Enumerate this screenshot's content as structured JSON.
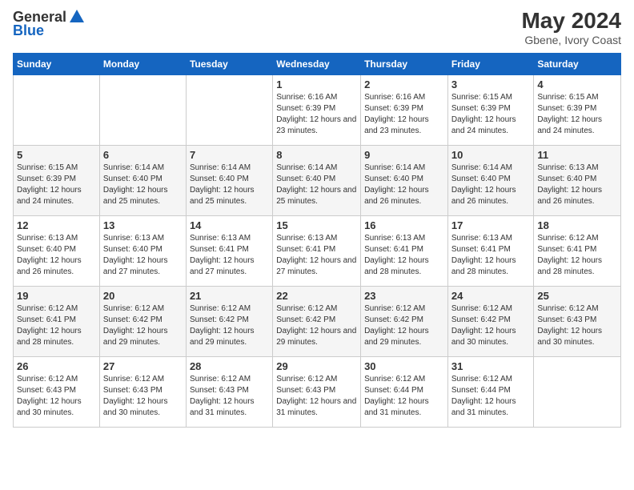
{
  "header": {
    "logo_general": "General",
    "logo_blue": "Blue",
    "month_year": "May 2024",
    "location": "Gbene, Ivory Coast"
  },
  "days_of_week": [
    "Sunday",
    "Monday",
    "Tuesday",
    "Wednesday",
    "Thursday",
    "Friday",
    "Saturday"
  ],
  "weeks": [
    [
      {
        "day": "",
        "sunrise": "",
        "sunset": "",
        "daylight": ""
      },
      {
        "day": "",
        "sunrise": "",
        "sunset": "",
        "daylight": ""
      },
      {
        "day": "",
        "sunrise": "",
        "sunset": "",
        "daylight": ""
      },
      {
        "day": "1",
        "sunrise": "Sunrise: 6:16 AM",
        "sunset": "Sunset: 6:39 PM",
        "daylight": "Daylight: 12 hours and 23 minutes."
      },
      {
        "day": "2",
        "sunrise": "Sunrise: 6:16 AM",
        "sunset": "Sunset: 6:39 PM",
        "daylight": "Daylight: 12 hours and 23 minutes."
      },
      {
        "day": "3",
        "sunrise": "Sunrise: 6:15 AM",
        "sunset": "Sunset: 6:39 PM",
        "daylight": "Daylight: 12 hours and 24 minutes."
      },
      {
        "day": "4",
        "sunrise": "Sunrise: 6:15 AM",
        "sunset": "Sunset: 6:39 PM",
        "daylight": "Daylight: 12 hours and 24 minutes."
      }
    ],
    [
      {
        "day": "5",
        "sunrise": "Sunrise: 6:15 AM",
        "sunset": "Sunset: 6:39 PM",
        "daylight": "Daylight: 12 hours and 24 minutes."
      },
      {
        "day": "6",
        "sunrise": "Sunrise: 6:14 AM",
        "sunset": "Sunset: 6:40 PM",
        "daylight": "Daylight: 12 hours and 25 minutes."
      },
      {
        "day": "7",
        "sunrise": "Sunrise: 6:14 AM",
        "sunset": "Sunset: 6:40 PM",
        "daylight": "Daylight: 12 hours and 25 minutes."
      },
      {
        "day": "8",
        "sunrise": "Sunrise: 6:14 AM",
        "sunset": "Sunset: 6:40 PM",
        "daylight": "Daylight: 12 hours and 25 minutes."
      },
      {
        "day": "9",
        "sunrise": "Sunrise: 6:14 AM",
        "sunset": "Sunset: 6:40 PM",
        "daylight": "Daylight: 12 hours and 26 minutes."
      },
      {
        "day": "10",
        "sunrise": "Sunrise: 6:14 AM",
        "sunset": "Sunset: 6:40 PM",
        "daylight": "Daylight: 12 hours and 26 minutes."
      },
      {
        "day": "11",
        "sunrise": "Sunrise: 6:13 AM",
        "sunset": "Sunset: 6:40 PM",
        "daylight": "Daylight: 12 hours and 26 minutes."
      }
    ],
    [
      {
        "day": "12",
        "sunrise": "Sunrise: 6:13 AM",
        "sunset": "Sunset: 6:40 PM",
        "daylight": "Daylight: 12 hours and 26 minutes."
      },
      {
        "day": "13",
        "sunrise": "Sunrise: 6:13 AM",
        "sunset": "Sunset: 6:40 PM",
        "daylight": "Daylight: 12 hours and 27 minutes."
      },
      {
        "day": "14",
        "sunrise": "Sunrise: 6:13 AM",
        "sunset": "Sunset: 6:41 PM",
        "daylight": "Daylight: 12 hours and 27 minutes."
      },
      {
        "day": "15",
        "sunrise": "Sunrise: 6:13 AM",
        "sunset": "Sunset: 6:41 PM",
        "daylight": "Daylight: 12 hours and 27 minutes."
      },
      {
        "day": "16",
        "sunrise": "Sunrise: 6:13 AM",
        "sunset": "Sunset: 6:41 PM",
        "daylight": "Daylight: 12 hours and 28 minutes."
      },
      {
        "day": "17",
        "sunrise": "Sunrise: 6:13 AM",
        "sunset": "Sunset: 6:41 PM",
        "daylight": "Daylight: 12 hours and 28 minutes."
      },
      {
        "day": "18",
        "sunrise": "Sunrise: 6:12 AM",
        "sunset": "Sunset: 6:41 PM",
        "daylight": "Daylight: 12 hours and 28 minutes."
      }
    ],
    [
      {
        "day": "19",
        "sunrise": "Sunrise: 6:12 AM",
        "sunset": "Sunset: 6:41 PM",
        "daylight": "Daylight: 12 hours and 28 minutes."
      },
      {
        "day": "20",
        "sunrise": "Sunrise: 6:12 AM",
        "sunset": "Sunset: 6:42 PM",
        "daylight": "Daylight: 12 hours and 29 minutes."
      },
      {
        "day": "21",
        "sunrise": "Sunrise: 6:12 AM",
        "sunset": "Sunset: 6:42 PM",
        "daylight": "Daylight: 12 hours and 29 minutes."
      },
      {
        "day": "22",
        "sunrise": "Sunrise: 6:12 AM",
        "sunset": "Sunset: 6:42 PM",
        "daylight": "Daylight: 12 hours and 29 minutes."
      },
      {
        "day": "23",
        "sunrise": "Sunrise: 6:12 AM",
        "sunset": "Sunset: 6:42 PM",
        "daylight": "Daylight: 12 hours and 29 minutes."
      },
      {
        "day": "24",
        "sunrise": "Sunrise: 6:12 AM",
        "sunset": "Sunset: 6:42 PM",
        "daylight": "Daylight: 12 hours and 30 minutes."
      },
      {
        "day": "25",
        "sunrise": "Sunrise: 6:12 AM",
        "sunset": "Sunset: 6:43 PM",
        "daylight": "Daylight: 12 hours and 30 minutes."
      }
    ],
    [
      {
        "day": "26",
        "sunrise": "Sunrise: 6:12 AM",
        "sunset": "Sunset: 6:43 PM",
        "daylight": "Daylight: 12 hours and 30 minutes."
      },
      {
        "day": "27",
        "sunrise": "Sunrise: 6:12 AM",
        "sunset": "Sunset: 6:43 PM",
        "daylight": "Daylight: 12 hours and 30 minutes."
      },
      {
        "day": "28",
        "sunrise": "Sunrise: 6:12 AM",
        "sunset": "Sunset: 6:43 PM",
        "daylight": "Daylight: 12 hours and 31 minutes."
      },
      {
        "day": "29",
        "sunrise": "Sunrise: 6:12 AM",
        "sunset": "Sunset: 6:43 PM",
        "daylight": "Daylight: 12 hours and 31 minutes."
      },
      {
        "day": "30",
        "sunrise": "Sunrise: 6:12 AM",
        "sunset": "Sunset: 6:44 PM",
        "daylight": "Daylight: 12 hours and 31 minutes."
      },
      {
        "day": "31",
        "sunrise": "Sunrise: 6:12 AM",
        "sunset": "Sunset: 6:44 PM",
        "daylight": "Daylight: 12 hours and 31 minutes."
      },
      {
        "day": "",
        "sunrise": "",
        "sunset": "",
        "daylight": ""
      }
    ]
  ]
}
